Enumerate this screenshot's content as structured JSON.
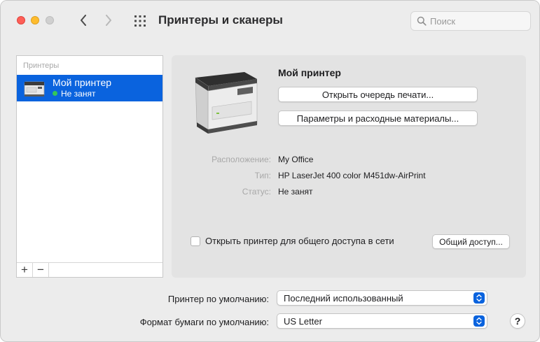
{
  "window": {
    "title": "Принтеры и сканеры"
  },
  "search": {
    "placeholder": "Поиск",
    "value": ""
  },
  "sidebar": {
    "header": "Принтеры",
    "items": [
      {
        "name": "Мой принтер",
        "status": "Не занят",
        "status_color": "#34c759",
        "selected": true
      }
    ],
    "add_symbol": "+",
    "remove_symbol": "−"
  },
  "details": {
    "printer_name": "Мой принтер",
    "open_queue_label": "Открыть очередь печати...",
    "options_label": "Параметры и расходные материалы...",
    "location_label": "Расположение:",
    "location_value": "My Office",
    "type_label": "Тип:",
    "type_value": "HP LaserJet 400 color M451dw-AirPrint",
    "status_label": "Статус:",
    "status_value": "Не занят",
    "share_checkbox_label": "Открыть принтер для общего доступа в сети",
    "share_checked": false,
    "sharing_button_label": "Общий доступ..."
  },
  "defaults": {
    "default_printer_label": "Принтер по умолчанию:",
    "default_printer_value": "Последний использованный",
    "paper_size_label": "Формат бумаги по умолчанию:",
    "paper_size_value": "US Letter"
  },
  "help_symbol": "?",
  "colors": {
    "accent": "#0a63de",
    "close": "#fe5f57",
    "minimize": "#febc2e",
    "zoom_inactive": "#d0d0d0"
  }
}
